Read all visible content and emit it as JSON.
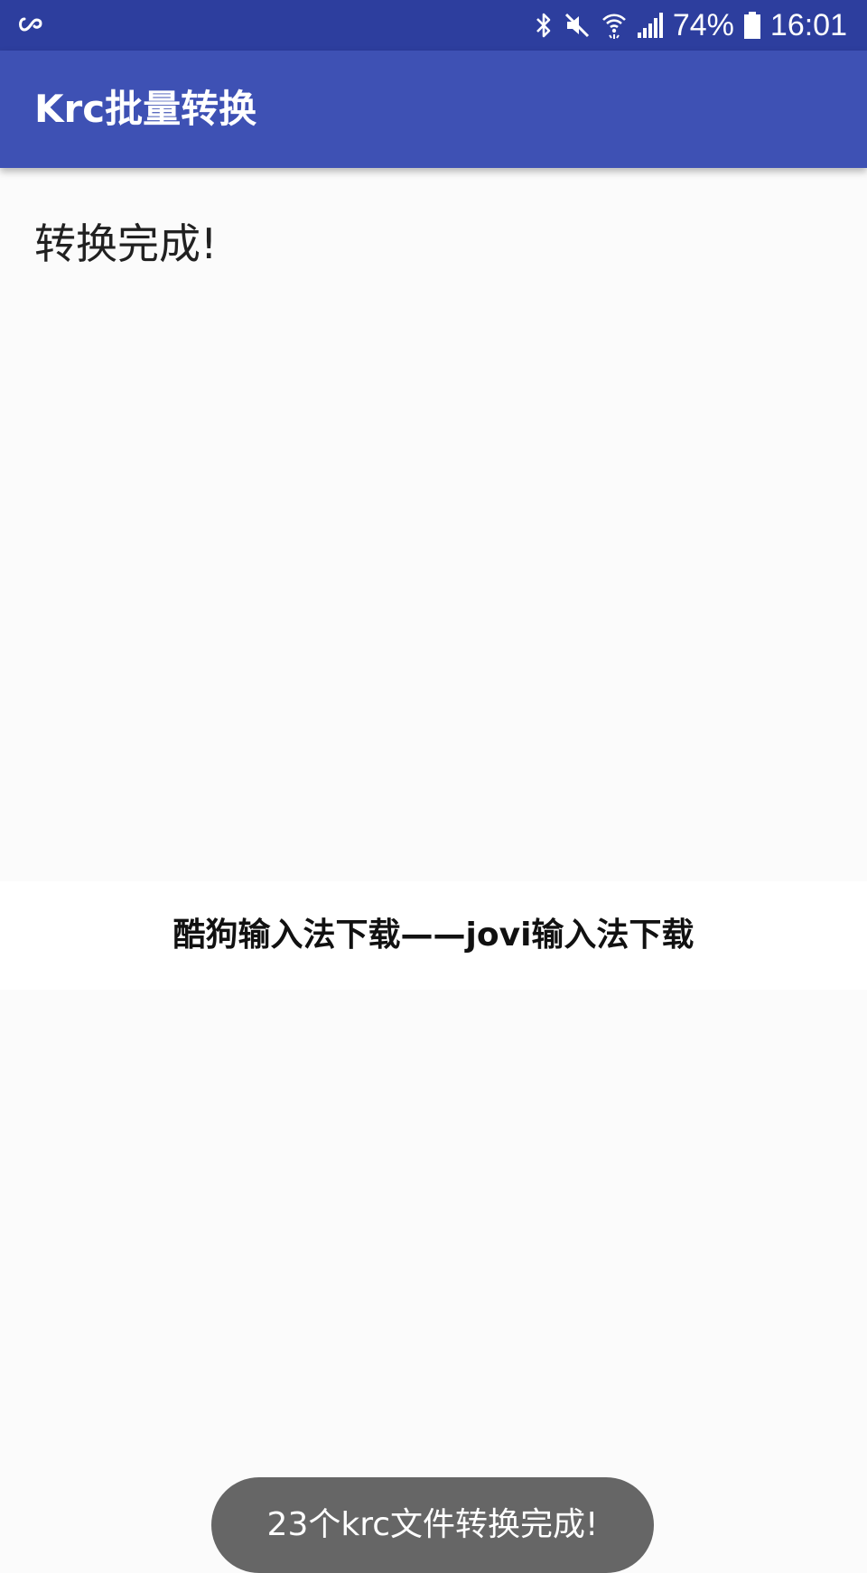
{
  "status_bar": {
    "battery_text": "74%",
    "time": "16:01",
    "icons": [
      "infinity-icon",
      "bluetooth-icon",
      "mute-icon",
      "wifi-icon",
      "signal-icon",
      "battery-icon"
    ],
    "background": "#2d3e9e"
  },
  "app_bar": {
    "title": "Krc批量转换",
    "color": "#3e51b4"
  },
  "content": {
    "result_text": "转换完成!"
  },
  "watermark": {
    "text": "酷狗输入法下载——jovi输入法下载"
  },
  "toast": {
    "message": "23个krc文件转换完成!",
    "color": "#666666"
  }
}
